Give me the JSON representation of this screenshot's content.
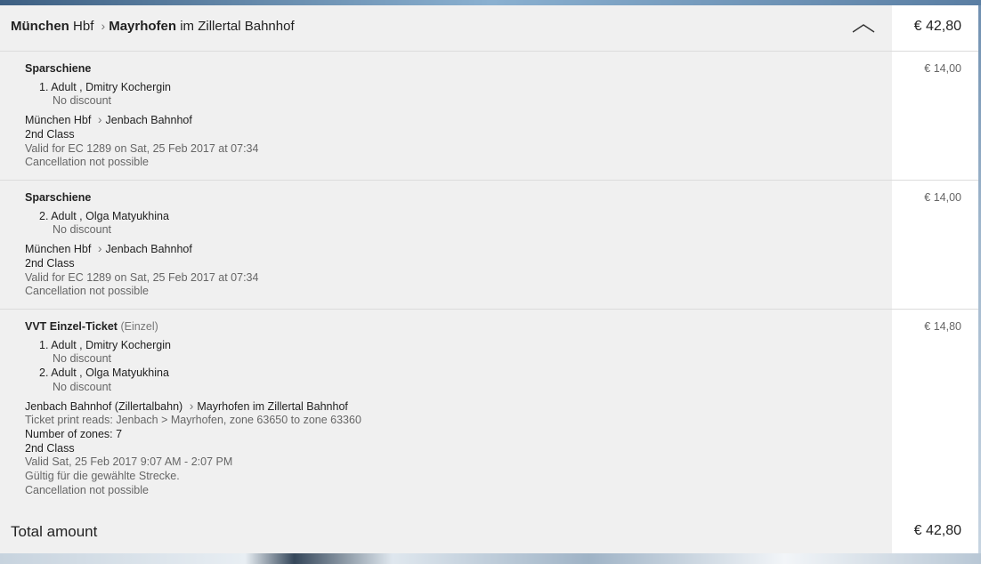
{
  "header": {
    "from": "München",
    "from_suffix": "Hbf",
    "to": "Mayrhofen",
    "to_suffix": "im Zillertal Bahnhof",
    "separator": ">",
    "price": "€ 42,80",
    "collapse_icon": "chevron-up-icon"
  },
  "tickets": [
    {
      "name": "Sparschiene",
      "price": "€ 14,00",
      "passengers": [
        {
          "label": "1. Adult , Dmitry Kochergin",
          "discount": "No discount"
        }
      ],
      "route_from": "München Hbf",
      "route_to": "Jenbach Bahnhof",
      "class": "2nd Class",
      "validity": "Valid for EC 1289 on Sat, 25 Feb 2017 at 07:34",
      "cancellation": "Cancellation not possible"
    },
    {
      "name": "Sparschiene",
      "price": "€ 14,00",
      "passengers": [
        {
          "label": "2. Adult , Olga Matyukhina",
          "discount": "No discount"
        }
      ],
      "route_from": "München Hbf",
      "route_to": "Jenbach Bahnhof",
      "class": "2nd Class",
      "validity": "Valid for EC 1289 on Sat, 25 Feb 2017 at 07:34",
      "cancellation": "Cancellation not possible"
    },
    {
      "name": "VVT Einzel-Ticket",
      "name_suffix": "(Einzel)",
      "price": "€ 14,80",
      "passengers": [
        {
          "label": "1. Adult , Dmitry Kochergin",
          "discount": "No discount"
        },
        {
          "label": "2. Adult , Olga Matyukhina",
          "discount": "No discount"
        }
      ],
      "route_from": "Jenbach Bahnhof (Zillertalbahn)",
      "route_to": "Mayrhofen im Zillertal Bahnhof",
      "print_reads": "Ticket print reads: Jenbach > Mayrhofen, zone 63650 to zone 63360",
      "zones": "Number of zones: 7",
      "class": "2nd Class",
      "validity": "Valid Sat, 25 Feb 2017 9:07 AM - 2:07 PM",
      "note": "Gültig für die gewählte Strecke.",
      "cancellation": "Cancellation not possible"
    }
  ],
  "total": {
    "label": "Total amount",
    "value": "€ 42,80"
  }
}
